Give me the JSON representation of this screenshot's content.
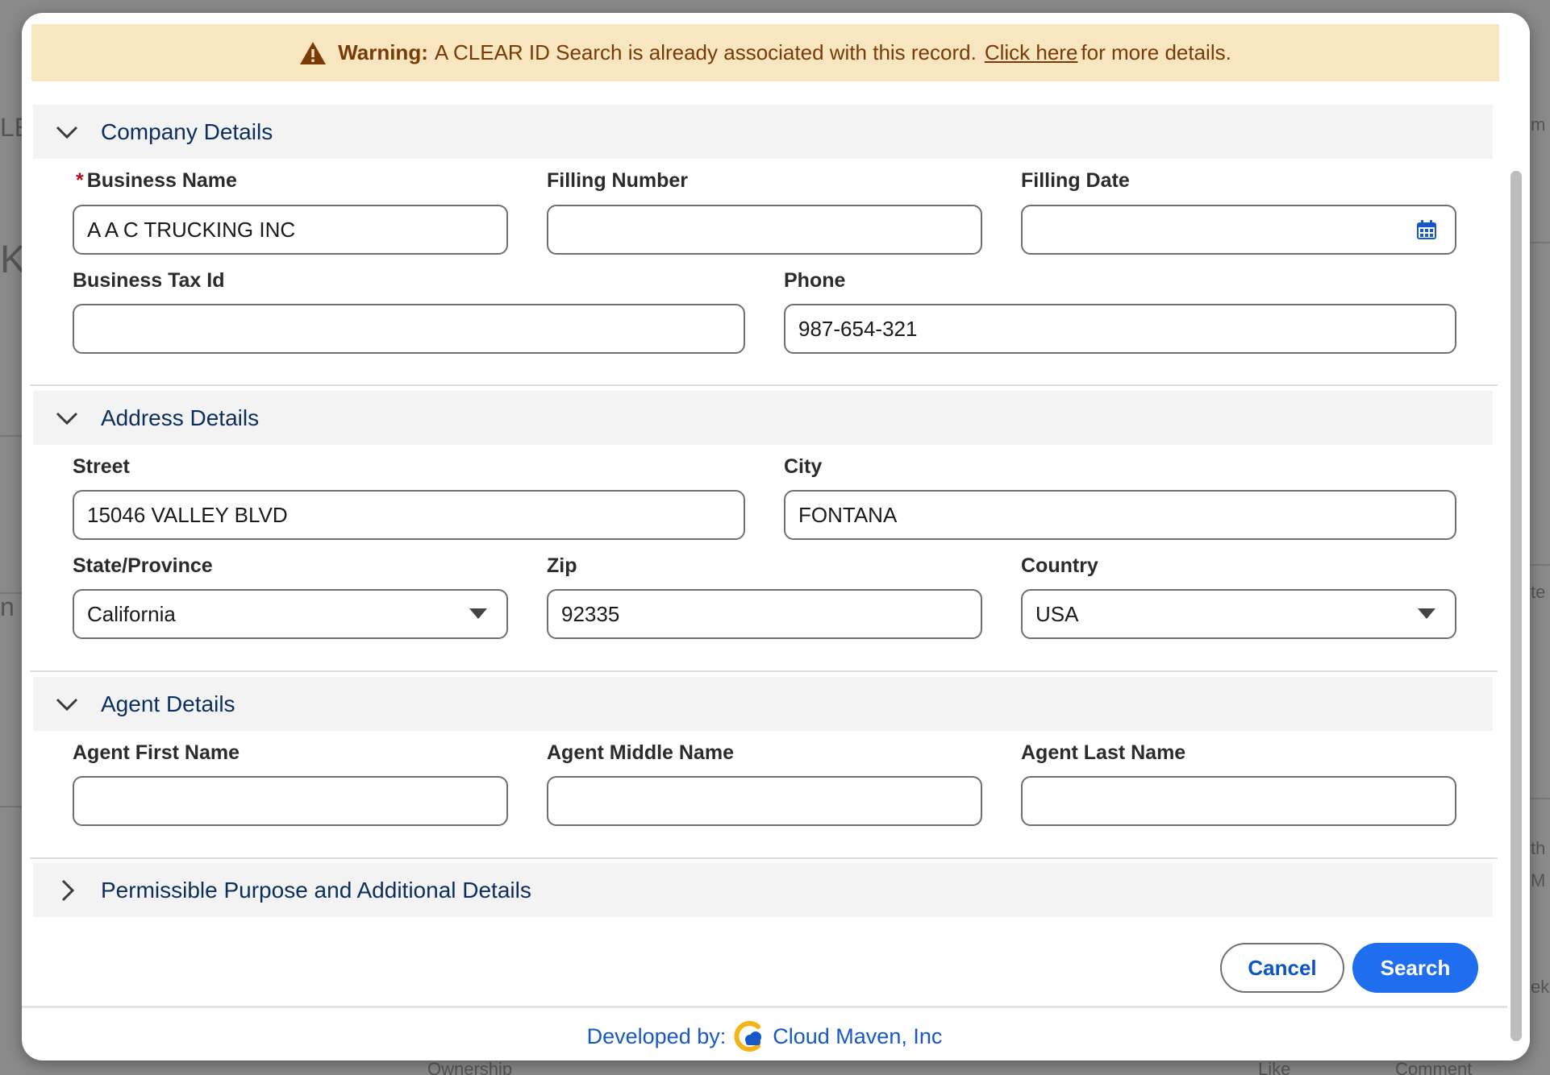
{
  "background": {
    "frag_left_1": "LE",
    "frag_left_2": "K",
    "frag_left_3": "n",
    "frag_right_1": "m",
    "frag_right_2": "te",
    "frag_right_3": "th",
    "frag_right_4": "M",
    "frag_right_5": "ek",
    "frag_bottom_1": "Ownership",
    "like_label": "Like",
    "comment_label": "Comment"
  },
  "warning": {
    "icon": "warning-triangle-icon",
    "bold": "Warning:",
    "text": "A CLEAR ID Search is already associated with this record.",
    "link": "Click here",
    "tail": "for more details.",
    "color": "#7a3a08",
    "bg": "#f7e6bf"
  },
  "sections": {
    "company": {
      "title": "Company Details",
      "expanded": true
    },
    "address": {
      "title": "Address Details",
      "expanded": true
    },
    "agent": {
      "title": "Agent Details",
      "expanded": true
    },
    "purpose": {
      "title": "Permissible Purpose and Additional Details",
      "expanded": false
    }
  },
  "company": {
    "business_name": {
      "label": "Business Name",
      "required": "*",
      "value": "A A C TRUCKING INC"
    },
    "filling_number": {
      "label": "Filling Number",
      "value": ""
    },
    "filling_date": {
      "label": "Filling Date",
      "value": "",
      "icon": "calendar-icon"
    },
    "business_tax_id": {
      "label": "Business Tax Id",
      "value": ""
    },
    "phone": {
      "label": "Phone",
      "value": "987-654-321"
    }
  },
  "address": {
    "street": {
      "label": "Street",
      "value": "15046 VALLEY BLVD"
    },
    "city": {
      "label": "City",
      "value": "FONTANA"
    },
    "state": {
      "label": "State/Province",
      "value": "California"
    },
    "zip": {
      "label": "Zip",
      "value": "92335"
    },
    "country": {
      "label": "Country",
      "value": "USA"
    }
  },
  "agent": {
    "first_name": {
      "label": "Agent First Name",
      "value": ""
    },
    "middle_name": {
      "label": "Agent Middle Name",
      "value": ""
    },
    "last_name": {
      "label": "Agent Last Name",
      "value": ""
    }
  },
  "actions": {
    "cancel": "Cancel",
    "search": "Search",
    "primary_color": "#1f6ef0"
  },
  "footer": {
    "prefix": "Developed by:",
    "company": "Cloud Maven, Inc",
    "logo": "cloud-maven-logo-icon"
  }
}
